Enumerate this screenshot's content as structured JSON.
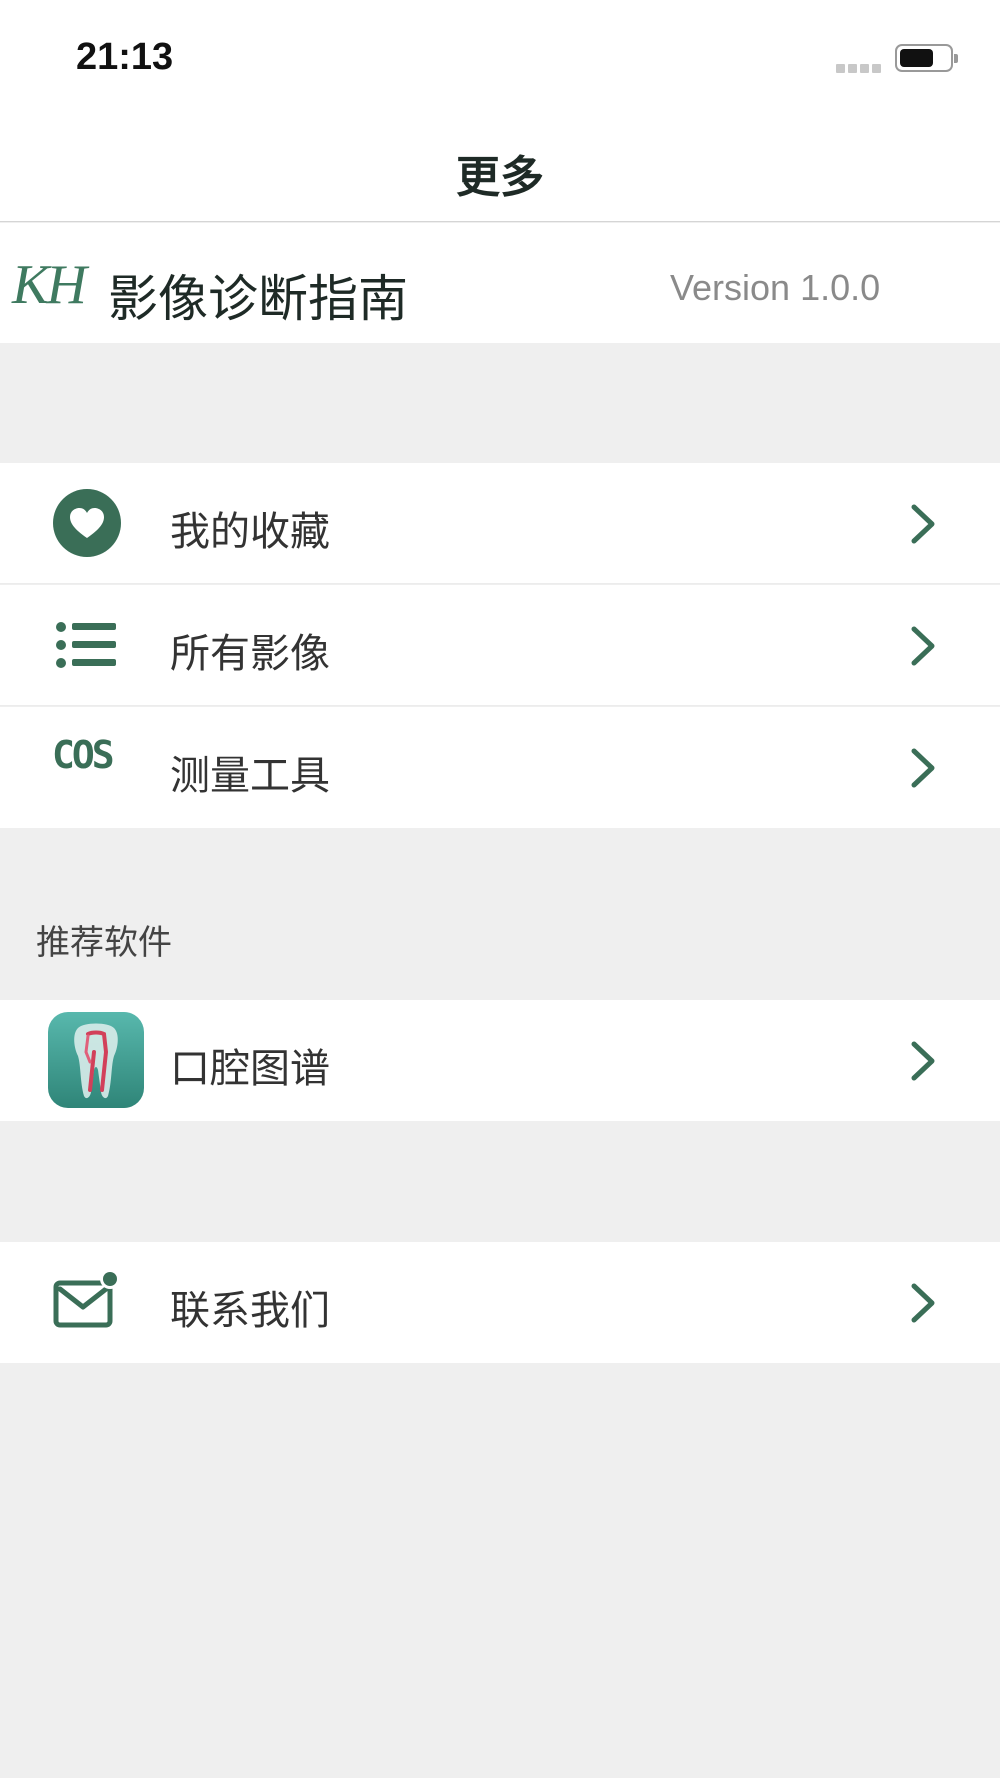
{
  "status_bar": {
    "time": "21:13"
  },
  "nav": {
    "title": "更多"
  },
  "app_header": {
    "logo": "KH",
    "name": "影像诊断指南",
    "version": "Version 1.0.0"
  },
  "menu": {
    "items": [
      {
        "label": "我的收藏",
        "icon": "heart-icon"
      },
      {
        "label": "所有影像",
        "icon": "list-icon"
      },
      {
        "label": "测量工具",
        "icon": "cos-icon",
        "icon_text": "COS"
      }
    ]
  },
  "recommended": {
    "title": "推荐软件",
    "items": [
      {
        "label": "口腔图谱",
        "icon": "tooth-app-icon"
      }
    ]
  },
  "contact": {
    "label": "联系我们",
    "icon": "mail-icon"
  },
  "colors": {
    "accent": "#3a6e57",
    "background": "#efefef",
    "row_background": "#ffffff"
  }
}
